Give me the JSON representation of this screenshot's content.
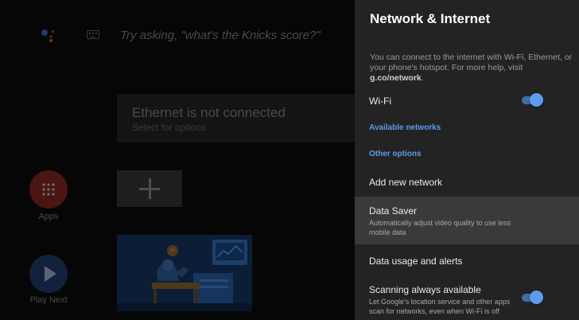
{
  "home": {
    "search_hint": "Try asking, \"what's the Knicks score?\"",
    "ethernet_card": {
      "title": "Ethernet is not connected",
      "subtitle": "Select for options"
    },
    "apps_label": "Apps",
    "play_next_label": "Play Next"
  },
  "panel": {
    "title": "Network & Internet",
    "description_prefix": "You can connect to the internet with Wi-Fi, Ethernet, or your phone's hotspot. For more help, visit ",
    "description_link": "g.co/network",
    "description_suffix": ".",
    "wifi": {
      "label": "Wi-Fi",
      "enabled": true
    },
    "available_networks_label": "Available networks",
    "other_options_label": "Other options",
    "add_network_label": "Add new network",
    "data_saver": {
      "label": "Data Saver",
      "subtitle": "Automatically adjust video quality to use less mobile data"
    },
    "data_usage_label": "Data usage and alerts",
    "scanning": {
      "label": "Scanning always available",
      "subtitle": "Let Google's location service and other apps scan for networks, even when Wi-Fi is off",
      "enabled": true
    }
  },
  "colors": {
    "panel_bg": "#232323",
    "selected_row_bg": "#3a3a3a",
    "accent": "#5e9bec"
  }
}
